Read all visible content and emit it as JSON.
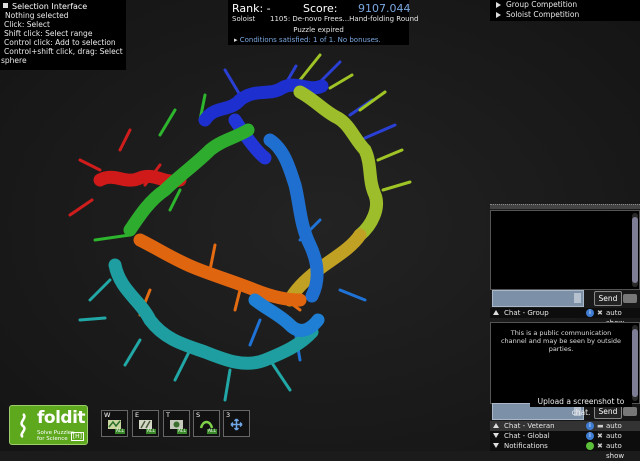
{
  "selection_panel": {
    "title": "Selection Interface",
    "lines": [
      "Nothing selected",
      "Click: Select",
      "Shift click: Select range",
      "Control click: Add to selection",
      "Control+shift click, drag: Select",
      "sphere"
    ]
  },
  "score_panel": {
    "rank_label": "Rank: -",
    "score_label": "Score:",
    "score_value": "9107.044",
    "role": "Soloist",
    "puzzle_name": "1105: De-novo Frees...Hand-folding Round",
    "status": "Puzzle expired",
    "conditions": "Conditions satisfied: 1 of 1. No bonuses."
  },
  "competitions": [
    "Group Competition",
    "Soloist Competition"
  ],
  "chat": {
    "group_tab": "Chat - Group",
    "veteran_tab": "Chat - Veteran",
    "global_tab": "Chat - Global",
    "notifications_tab": "Notifications",
    "auto_show": "auto show",
    "send_label": "Send",
    "notice": "This is a public communication channel and may be seen by outside parties.",
    "screenshot_tooltip": "Upload a screenshot to chat."
  },
  "logo": {
    "name": "foldit",
    "tagline_1": "Solve Puzzles",
    "tagline_2": "for Science",
    "version_badge": "[H]"
  },
  "toolbar": [
    {
      "key": "W",
      "icon": "wiggle-icon"
    },
    {
      "key": "E",
      "icon": "sidechain-icon"
    },
    {
      "key": "T",
      "icon": "tweak-icon"
    },
    {
      "key": "S",
      "icon": "shake-icon"
    },
    {
      "key": "3",
      "icon": "move-icon"
    }
  ],
  "colors": {
    "score_value": "#7aa8e0",
    "logo_green": "#5ea81e",
    "chat_input": "#7c90a8"
  }
}
